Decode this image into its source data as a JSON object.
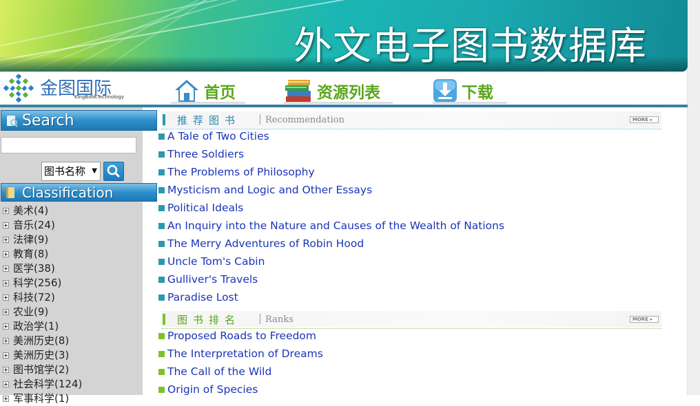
{
  "banner": {
    "title": "外文电子图书数据库"
  },
  "logo": {
    "name": "金图国际",
    "sub": "KingBookTechnology"
  },
  "nav": [
    {
      "label": "首页",
      "icon": "home-icon"
    },
    {
      "label": "资源列表",
      "icon": "books-icon"
    },
    {
      "label": "下载",
      "icon": "download-icon"
    }
  ],
  "search": {
    "title": "Search",
    "input_value": "",
    "select_value": "图书名称",
    "button_icon": "search-icon"
  },
  "classification": {
    "title": "Classification",
    "items": [
      "美术(4)",
      "音乐(24)",
      "法律(9)",
      "教育(8)",
      "医学(38)",
      "科学(256)",
      "科技(72)",
      "农业(9)",
      "政治学(1)",
      "美洲历史(8)",
      "美洲历史(3)",
      "图书馆学(2)",
      "社会科学(124)",
      "军事科学(1)"
    ]
  },
  "recommendation": {
    "title_cn": "推荐图书",
    "title_en": "Recommendation",
    "more": "MORE",
    "books": [
      "A Tale of Two Cities",
      "Three Soldiers",
      "The Problems of Philosophy",
      "Mysticism and Logic and Other Essays",
      "Political Ideals",
      "An Inquiry into the Nature and Causes of the Wealth of Nations",
      "The Merry Adventures of Robin Hood",
      "Uncle Tom's Cabin",
      "Gulliver's Travels",
      "Paradise Lost"
    ]
  },
  "ranks": {
    "title_cn": "图书排名",
    "title_en": "Ranks",
    "more": "MORE",
    "books": [
      "Proposed Roads to Freedom",
      "The Interpretation of Dreams",
      "The Call of the Wild",
      "Origin of Species"
    ]
  },
  "colors": {
    "accent_blue": "#3a7fa2",
    "nav_green": "#5aa61c",
    "link_blue": "#1a35b8",
    "rec_bullet": "#2d98b0",
    "rank_bullet": "#7cc22a"
  }
}
